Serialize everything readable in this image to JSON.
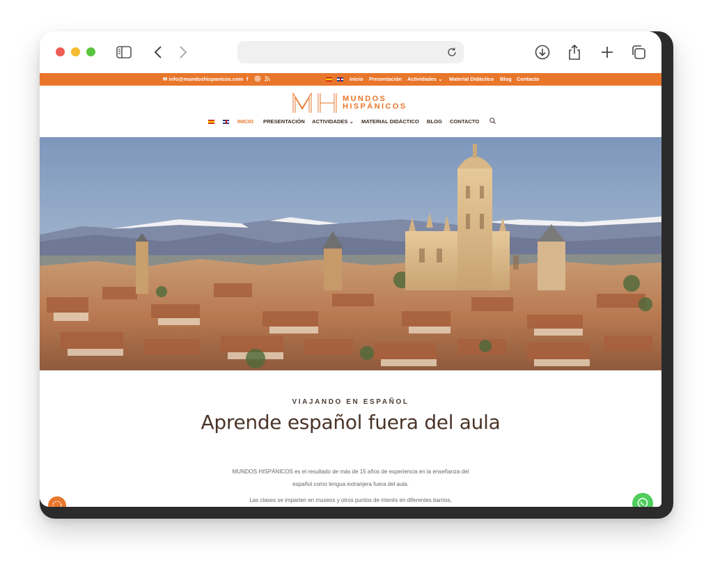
{
  "topbar": {
    "email": "info@mundoshispanicos.com",
    "nav": [
      "Inicio",
      "Presentación",
      "Actividades",
      "Material Didáctico",
      "Blog",
      "Contacto"
    ]
  },
  "logo": {
    "line1": "MUNDOS",
    "line2": "HISPÁNICOS"
  },
  "main_nav": {
    "items": [
      "INICIO",
      "PRESENTACIÓN",
      "ACTIVIDADES",
      "MATERIAL DIDÁCTICO",
      "BLOG",
      "CONTACTO"
    ]
  },
  "content": {
    "eyebrow": "VIAJANDO EN ESPAÑOL",
    "heading": "Aprende español fuera del aula",
    "para1_line1": "MUNDOS HISPÁNICOS es el resultado de más de 15 años de experiencia en la enseñanza del",
    "para1_line2": "español como lengua extranjera fuera del aula.",
    "para2_line1": "Las clases se imparten en museos y otros puntos de interés en diferentes barrios,"
  },
  "colors": {
    "brand_orange": "#e8762b",
    "dark_text": "#4a3428",
    "whatsapp_green": "#4fce5d"
  },
  "icons": [
    "sidebar-icon",
    "back-icon",
    "forward-icon",
    "reload-icon",
    "download-icon",
    "share-icon",
    "new-tab-icon",
    "tabs-icon",
    "mail-icon",
    "facebook-icon",
    "instagram-icon",
    "rss-icon",
    "search-icon",
    "whatsapp-icon"
  ]
}
